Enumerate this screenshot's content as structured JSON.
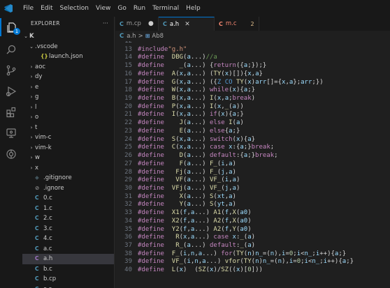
{
  "menu": [
    "File",
    "Edit",
    "Selection",
    "View",
    "Go",
    "Run",
    "Terminal",
    "Help"
  ],
  "explorer": {
    "title": "EXPLORER",
    "more": "···",
    "root": "K",
    "items": [
      {
        "label": ".vscode",
        "kind": "folder-open",
        "depth": 1
      },
      {
        "label": "launch.json",
        "kind": "json",
        "depth": 2
      },
      {
        "label": "aoc",
        "kind": "folder",
        "depth": 1
      },
      {
        "label": "dy",
        "kind": "folder",
        "depth": 1
      },
      {
        "label": "e",
        "kind": "folder",
        "depth": 1
      },
      {
        "label": "g",
        "kind": "folder",
        "depth": 1
      },
      {
        "label": "l",
        "kind": "folder",
        "depth": 1
      },
      {
        "label": "o",
        "kind": "folder",
        "depth": 1
      },
      {
        "label": "t",
        "kind": "folder",
        "depth": 1
      },
      {
        "label": "vim-c",
        "kind": "folder",
        "depth": 1
      },
      {
        "label": "vim-k",
        "kind": "folder",
        "depth": 1
      },
      {
        "label": "w",
        "kind": "folder",
        "depth": 1
      },
      {
        "label": "x",
        "kind": "folder",
        "depth": 1
      },
      {
        "label": ".gitignore",
        "kind": "git",
        "depth": 1
      },
      {
        "label": ".ignore",
        "kind": "ignore",
        "depth": 1
      },
      {
        "label": "0.c",
        "kind": "c",
        "depth": 1
      },
      {
        "label": "1.c",
        "kind": "c",
        "depth": 1
      },
      {
        "label": "2.c",
        "kind": "c",
        "depth": 1
      },
      {
        "label": "3.c",
        "kind": "c",
        "depth": 1
      },
      {
        "label": "4.c",
        "kind": "c",
        "depth": 1
      },
      {
        "label": "a.c",
        "kind": "c",
        "depth": 1
      },
      {
        "label": "a.h",
        "kind": "h",
        "depth": 1,
        "selected": true
      },
      {
        "label": "b.c",
        "kind": "c",
        "depth": 1
      },
      {
        "label": "b.cp",
        "kind": "c",
        "depth": 1
      },
      {
        "label": "c.c",
        "kind": "c",
        "depth": 1
      }
    ]
  },
  "activity_badge": "1",
  "tabs": [
    {
      "label": "m.cp",
      "icon": "C",
      "state": "dirty"
    },
    {
      "label": "a.h",
      "icon": "C",
      "state": "active"
    },
    {
      "label": "m.c",
      "icon": "C",
      "state": "error",
      "count": "2"
    }
  ],
  "breadcrumb": {
    "file_icon": "C",
    "file": "a.h",
    "sep": ">",
    "symbol": "Ab8"
  },
  "code": [
    {
      "n": "12",
      "t": ""
    },
    {
      "n": "13",
      "t": "#include\"g.h\""
    },
    {
      "n": "14",
      "t": "#define  DBG(a...)//a"
    },
    {
      "n": "15",
      "t": "#define    _(a...) {return({a;});}"
    },
    {
      "n": "16",
      "t": "#define  A(x,a...) (TY(x)[]){x,a}"
    },
    {
      "n": "17",
      "t": "#define  G(x,a...) ({Z CO TY(x)arr[]={x,a};arr;})"
    },
    {
      "n": "18",
      "t": "#define  W(x,a...) while(x){a;}"
    },
    {
      "n": "19",
      "t": "#define  B(x,a...) I(x,a;break)"
    },
    {
      "n": "20",
      "t": "#define  P(x,a...) I(x,_(a))"
    },
    {
      "n": "21",
      "t": "#define  I(x,a...) if(x){a;}"
    },
    {
      "n": "22",
      "t": "#define    J(a...) else I(a)"
    },
    {
      "n": "23",
      "t": "#define    E(a...) else{a;}"
    },
    {
      "n": "24",
      "t": "#define  S(x,a...) switch(x){a}"
    },
    {
      "n": "25",
      "t": "#define  C(x,a...) case x:{a;}break;"
    },
    {
      "n": "26",
      "t": "#define    D(a...) default:{a;}break;"
    },
    {
      "n": "27",
      "t": "#define    F(a...) F_(i,a)"
    },
    {
      "n": "28",
      "t": "#define   Fj(a...) F_(j,a)"
    },
    {
      "n": "29",
      "t": "#define   VF(a...) VF_(i,a)"
    },
    {
      "n": "30",
      "t": "#define  VFj(a...) VF_(j,a)"
    },
    {
      "n": "31",
      "t": "#define    X(a...) S(xt,a)"
    },
    {
      "n": "32",
      "t": "#define    Y(a...) S(yt,a)"
    },
    {
      "n": "33",
      "t": "#define  X1(f,a...) A1(f,X(a0)"
    },
    {
      "n": "34",
      "t": "#define  X2(f,a...) A2(f,X(a0)"
    },
    {
      "n": "35",
      "t": "#define  Y2(f,a...) A2(f,Y(a0)"
    },
    {
      "n": "36",
      "t": "#define   R(x,a...) case x:_(a)"
    },
    {
      "n": "37",
      "t": "#define   R_(a...) default:_(a)"
    },
    {
      "n": "38",
      "t": "#define  F_(i,n,a...) for(TY(n)n_=(n),i=0;i<n_;i++){a;}"
    },
    {
      "n": "39",
      "t": "#define  VF_(i,n,a...) vfor(TY(n)n_=(n),i=0;i<n_;i++){a;}"
    },
    {
      "n": "40",
      "t": "#define  L(x)  (SZ(x)/SZ((x)[0]))"
    }
  ]
}
